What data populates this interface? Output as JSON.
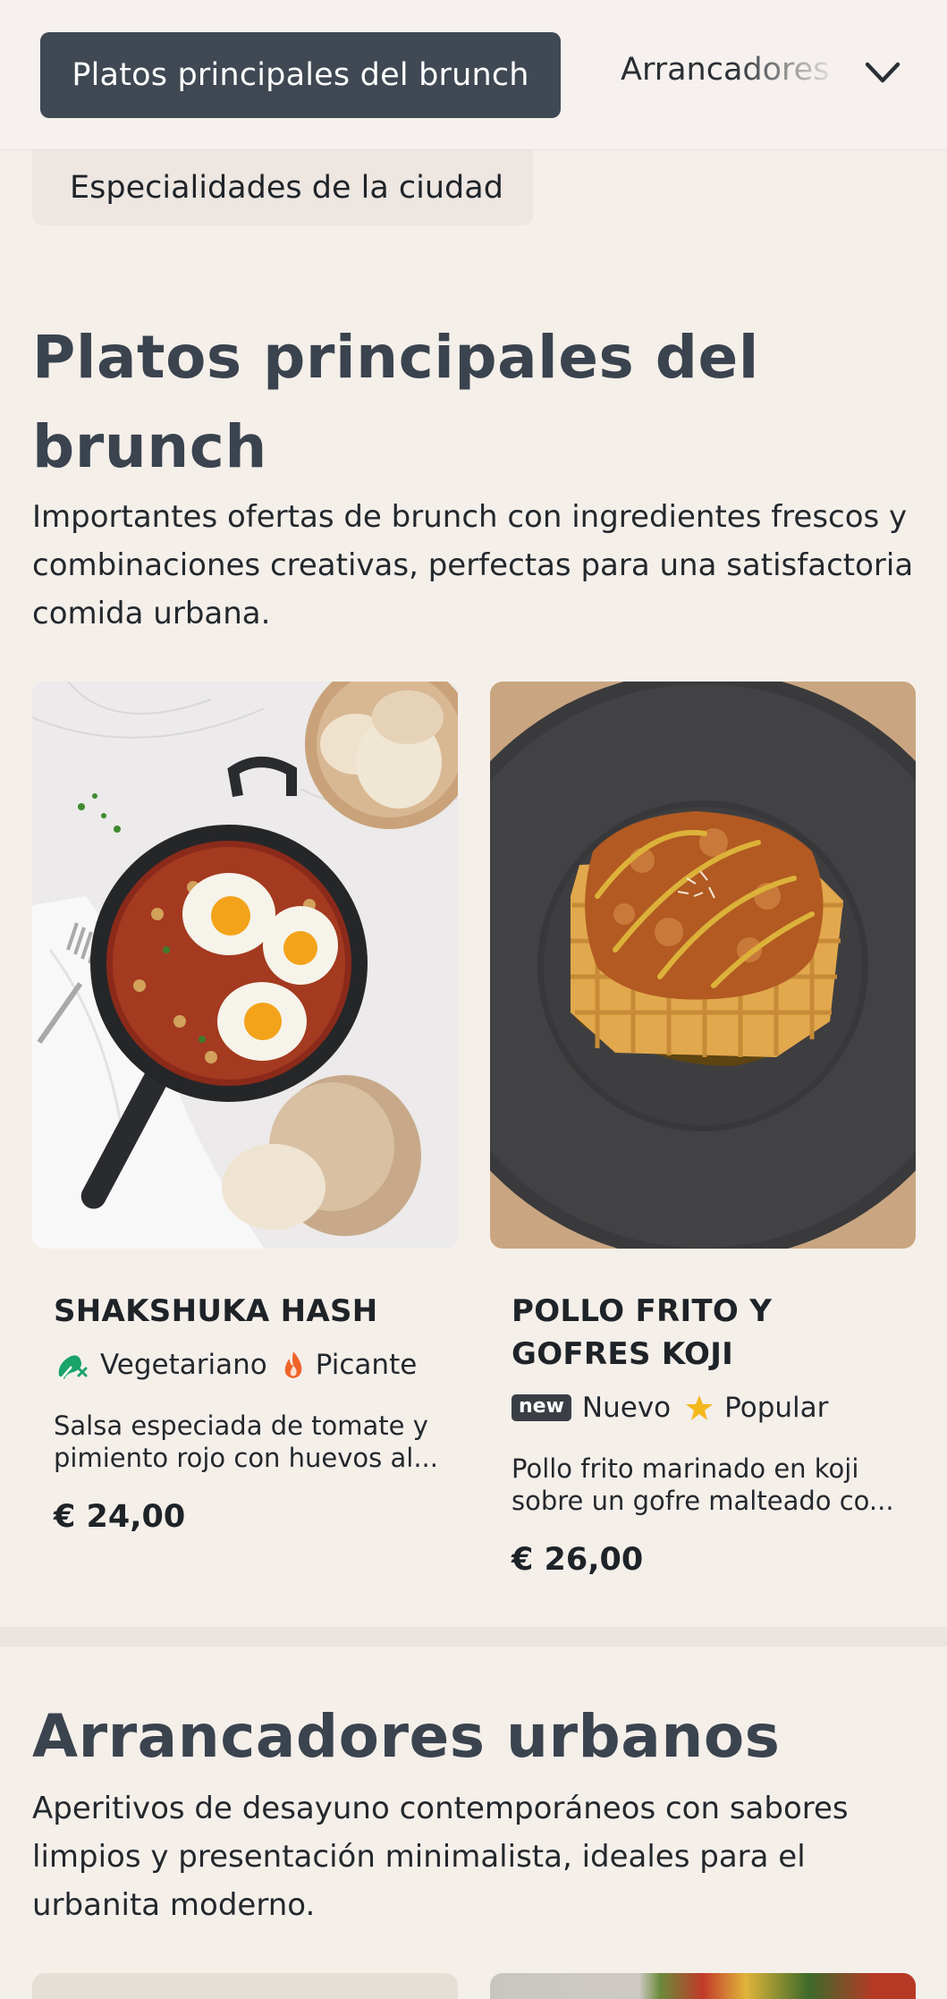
{
  "nav": {
    "active": "Platos principales del brunch",
    "next": "Arrancadores",
    "second_row": "Especialidades de la ciudad"
  },
  "section1": {
    "title": "Platos principales del brunch",
    "description": "Importantes ofertas de brunch con ingredientes frescos y combinaciones creativas, perfectas para una satisfactoria comida urbana.",
    "cards": [
      {
        "title": "SHAKSHUKA HASH",
        "tags": [
          {
            "icon": "vegetarian-icon",
            "label": "Vegetariano"
          },
          {
            "icon": "flame-icon",
            "label": "Picante"
          }
        ],
        "description": "Salsa especiada de tomate y pimiento rojo con huevos al...",
        "price": "€ 24,00"
      },
      {
        "title": "POLLO FRITO Y GOFRES KOJI",
        "tags": [
          {
            "icon": "new-badge",
            "badge": "new",
            "label": "Nuevo"
          },
          {
            "icon": "star-icon",
            "label": "Popular"
          }
        ],
        "description": "Pollo frito marinado en koji sobre un gofre malteado co...",
        "price": "€ 26,00"
      }
    ]
  },
  "section2": {
    "title": "Arrancadores urbanos",
    "description": "Aperitivos de desayuno contemporáneos con sabores limpios y presentación minimalista, ideales para el urbanita moderno."
  },
  "colors": {
    "background": "#f5efea",
    "nav_active": "#3f4853",
    "heading": "#3a434e",
    "vegetarian": "#1aa36a",
    "flame": "#f0642a",
    "star": "#f4b71c"
  }
}
